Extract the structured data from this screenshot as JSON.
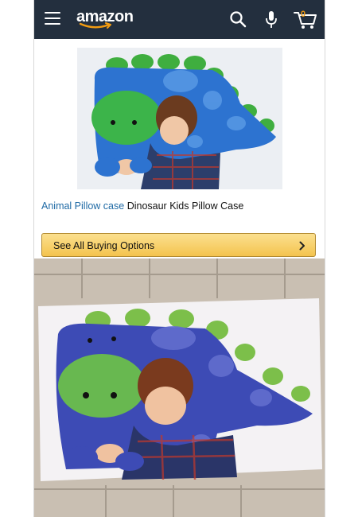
{
  "header": {
    "logo_text": "amazon",
    "cart_count": "0",
    "bg_color": "#232f3e",
    "icons": [
      "menu-icon",
      "search-icon",
      "microphone-icon",
      "cart-icon"
    ]
  },
  "product": {
    "title_link": "Animal Pillow case",
    "title_rest": " Dinosaur Kids Pillow Case",
    "link_color": "#1f6aa5"
  },
  "buy_button": {
    "label": "See All Buying Options",
    "color": "#f4c34e"
  }
}
